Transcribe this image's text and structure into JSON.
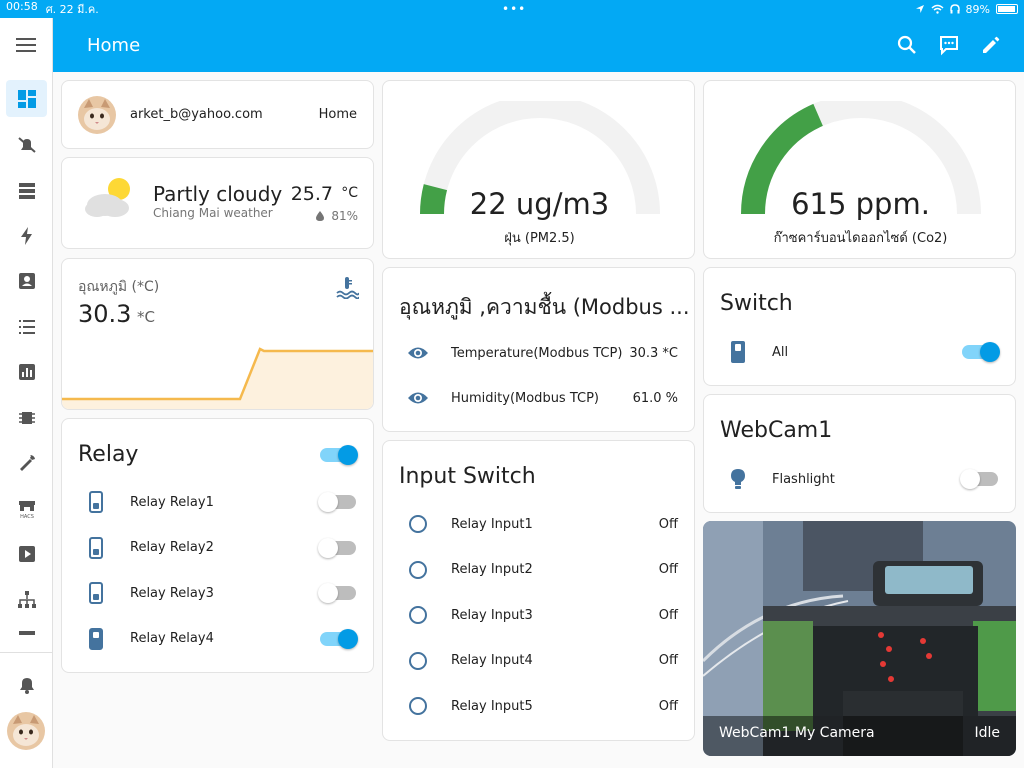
{
  "status": {
    "time": "00:58",
    "date": "ศ. 22 มี.ค.",
    "dots": "•••",
    "battery": "89%"
  },
  "topbar": {
    "title": "Home"
  },
  "profile": {
    "email": "arket_b@yahoo.com",
    "home": "Home"
  },
  "weather": {
    "condition": "Partly cloudy",
    "location": "Chiang Mai weather",
    "temperature": "25.7",
    "unit": "°C",
    "humidity": "81%"
  },
  "temp_card": {
    "label": "อุณหภูมิ (*C)",
    "value": "30.3",
    "unit": "*C"
  },
  "relay": {
    "title": "Relay",
    "items": [
      {
        "label": "Relay Relay1",
        "on": false
      },
      {
        "label": "Relay Relay2",
        "on": false
      },
      {
        "label": "Relay Relay3",
        "on": false
      },
      {
        "label": "Relay Relay4",
        "on": true
      }
    ]
  },
  "pm25": {
    "value": "22 ug/m3",
    "label": "ฝุ่น (PM2.5)",
    "level": 0.08
  },
  "co2": {
    "value": "615 ppm.",
    "label": "ก๊าซคาร์บอนไดออกไซด์ (Co2)",
    "level": 0.37
  },
  "modbus": {
    "title": "อุณหภูมิ ,ความชื้น (Modbus ...",
    "rows": [
      {
        "label": "Temperature(Modbus TCP)",
        "value": "30.3 *C"
      },
      {
        "label": "Humidity(Modbus TCP)",
        "value": "61.0 %"
      }
    ]
  },
  "input_switch": {
    "title": "Input Switch",
    "rows": [
      {
        "label": "Relay Input1",
        "value": "Off"
      },
      {
        "label": "Relay Input2",
        "value": "Off"
      },
      {
        "label": "Relay Input3",
        "value": "Off"
      },
      {
        "label": "Relay Input4",
        "value": "Off"
      },
      {
        "label": "Relay Input5",
        "value": "Off"
      }
    ]
  },
  "switch_card": {
    "title": "Switch",
    "item": "All"
  },
  "webcam_card": {
    "title": "WebCam1",
    "item": "Flashlight"
  },
  "camera": {
    "name": "WebCam1 My Camera",
    "state": "Idle"
  },
  "colors": {
    "accent": "#03a9f4",
    "icon": "#44739e",
    "gauge": "#43a047",
    "graph": "#f5b94d"
  },
  "icons": [
    "menu-icon",
    "dashboard-icon",
    "bell-off-icon",
    "server-icon",
    "lightning-icon",
    "account-box-icon",
    "list-icon",
    "chart-icon",
    "chip-icon",
    "wrench-icon",
    "hacs-icon",
    "media-icon",
    "sitemap-icon",
    "notification-bell-icon",
    "search-icon",
    "assist-icon",
    "edit-icon"
  ]
}
